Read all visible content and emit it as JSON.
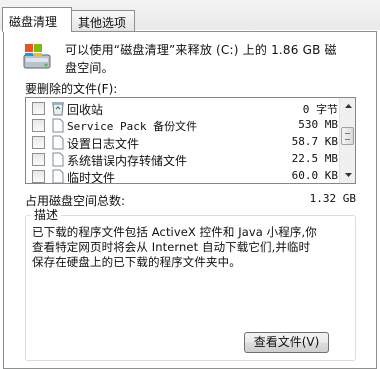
{
  "tabs": [
    "磁盘清理",
    "其他选项"
  ],
  "header": {
    "line1": "可以使用“磁盘清理”来释放  (C:) 上的 1.86 GB 磁",
    "line2": "盘空间。"
  },
  "files_label": "要删除的文件(F):",
  "items": [
    {
      "label": "回收站",
      "size": "0 字节",
      "icon": "recycle-bin-icon"
    },
    {
      "label": "Service Pack 备份文件",
      "size": "530 MB",
      "icon": "document-icon"
    },
    {
      "label": "设置日志文件",
      "size": "58.7 KB",
      "icon": "document-icon"
    },
    {
      "label": "系统错误内存转储文件",
      "size": "22.5 MB",
      "icon": "document-icon"
    },
    {
      "label": "临时文件",
      "size": "60.0 KB",
      "icon": "document-icon"
    }
  ],
  "total": {
    "label": "占用磁盘空间总数:",
    "value": "1.32 GB"
  },
  "description": {
    "title": "描述",
    "line1": "已下载的程序文件包括 ActiveX 控件和 Java 小程序,你",
    "line2": "查看特定网页时将会从 Internet 自动下载它们,并临时",
    "line3": "保存在硬盘上的已下载的程序文件夹中。"
  },
  "view_files_button": "查看文件(V)"
}
